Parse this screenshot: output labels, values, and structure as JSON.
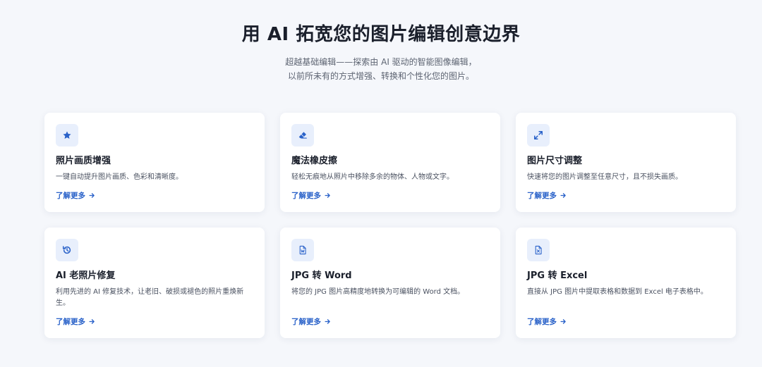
{
  "hero": {
    "title": "用 AI 拓宽您的图片编辑创意边界",
    "subtitle_line1": "超越基础编辑——探索由 AI 驱动的智能图像编辑，",
    "subtitle_line2": "以前所未有的方式增强、转换和个性化您的图片。"
  },
  "colors": {
    "accent": "#2a62c9",
    "icon_bg": "#e8effc",
    "page_bg": "#f5f7fb"
  },
  "cards": [
    {
      "icon": "star-icon",
      "title": "照片画质增强",
      "desc": "一键自动提升图片画质、色彩和清晰度。",
      "link": "了解更多"
    },
    {
      "icon": "eraser-icon",
      "title": "魔法橡皮擦",
      "desc": "轻松无痕地从照片中移除多余的物体、人物或文字。",
      "link": "了解更多"
    },
    {
      "icon": "resize-icon",
      "title": "图片尺寸调整",
      "desc": "快速将您的图片调整至任意尺寸，且不损失画质。",
      "link": "了解更多"
    },
    {
      "icon": "history-restore-icon",
      "title": "AI 老照片修复",
      "desc": "利用先进的 AI 修复技术，让老旧、破损或褪色的照片重焕新生。",
      "link": "了解更多"
    },
    {
      "icon": "word-file-icon",
      "title": "JPG 转 Word",
      "desc": "将您的 JPG 图片高精度地转换为可编辑的 Word 文档。",
      "link": "了解更多"
    },
    {
      "icon": "excel-file-icon",
      "title": "JPG 转 Excel",
      "desc": "直接从 JPG 图片中提取表格和数据到 Excel 电子表格中。",
      "link": "了解更多"
    }
  ]
}
